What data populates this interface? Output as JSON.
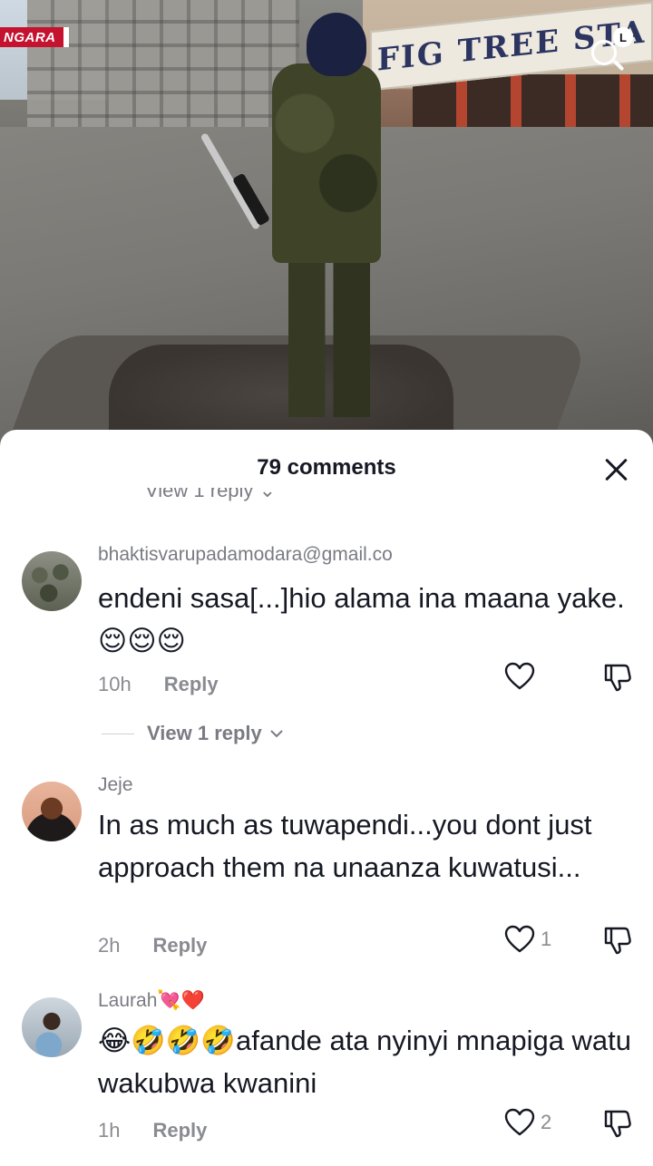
{
  "video": {
    "channel_tag": "NGARA",
    "sign_text": "FIG TREE STA",
    "search_badge": "L"
  },
  "sheet": {
    "title": "79 comments",
    "clipped_reply_label": "View 1 reply"
  },
  "comments": [
    {
      "username": "bhaktisvarupadamodara@gmail.co",
      "text": "endeni sasa[...]hio alama ina maana yake.😌😌😌",
      "time": "10h",
      "reply_label": "Reply",
      "likes": "",
      "view_replies_label": "View 1 reply"
    },
    {
      "username": "Jeje",
      "text": "In as much as tuwapendi...you dont just approach them na unaanza kuwatusi...",
      "time": "2h",
      "reply_label": "Reply",
      "likes": "1"
    },
    {
      "username": "Laurah💘❤️",
      "text": "😂🤣🤣🤣afande ata nyinyi mnapiga watu wakubwa kwanini",
      "time": "1h",
      "reply_label": "Reply",
      "likes": "2"
    }
  ],
  "icons": {
    "like": "heart-outline-icon",
    "dislike": "thumbs-down-outline-icon",
    "close": "close-icon",
    "search": "search-icon",
    "chevron": "chevron-down-icon"
  },
  "colors": {
    "tag_red": "#c4122f",
    "text_primary": "#161823",
    "text_secondary": "#8a8b91"
  }
}
